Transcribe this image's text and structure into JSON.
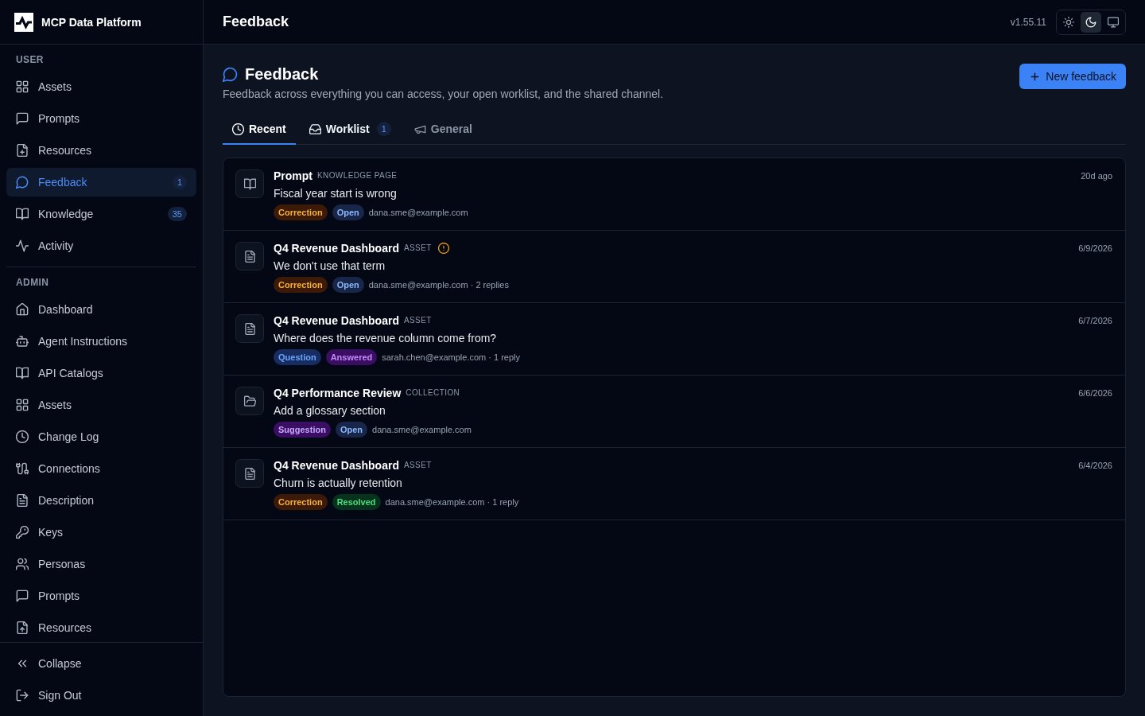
{
  "app": {
    "name": "MCP Data Platform"
  },
  "sidebar": {
    "sections": [
      {
        "heading": "USER",
        "items": [
          {
            "label": "Assets",
            "kind": "assets",
            "selected": false
          },
          {
            "label": "Prompts",
            "kind": "prompts",
            "selected": false
          },
          {
            "label": "Resources",
            "kind": "resources",
            "selected": false
          },
          {
            "label": "Feedback",
            "kind": "feedback",
            "badge": "1",
            "selected": true
          },
          {
            "label": "Knowledge",
            "kind": "knowledge",
            "badge": "35",
            "selected": false
          },
          {
            "label": "Activity",
            "kind": "activity",
            "selected": false
          }
        ]
      },
      {
        "heading": "ADMIN",
        "items": [
          {
            "label": "Dashboard",
            "kind": "dashboard",
            "selected": false
          },
          {
            "label": "Agent Instructions",
            "kind": "agent",
            "selected": false
          },
          {
            "label": "API Catalogs",
            "kind": "catalogs",
            "selected": false
          },
          {
            "label": "Assets",
            "kind": "assets",
            "selected": false
          },
          {
            "label": "Change Log",
            "kind": "changelog",
            "selected": false
          },
          {
            "label": "Connections",
            "kind": "connections",
            "selected": false
          },
          {
            "label": "Description",
            "kind": "description",
            "selected": false
          },
          {
            "label": "Keys",
            "kind": "keys",
            "selected": false
          },
          {
            "label": "Personas",
            "kind": "personas",
            "selected": false
          },
          {
            "label": "Prompts",
            "kind": "prompts",
            "selected": false
          },
          {
            "label": "Resources",
            "kind": "uploads",
            "selected": false
          }
        ]
      }
    ],
    "footer": [
      {
        "label": "Collapse",
        "kind": "collapse"
      },
      {
        "label": "Sign Out",
        "kind": "signout"
      }
    ]
  },
  "header": {
    "title": "Feedback",
    "version": "v1.55.11",
    "theme_modes": [
      {
        "kind": "light",
        "selected": false
      },
      {
        "kind": "dark",
        "selected": true
      },
      {
        "kind": "system",
        "selected": false
      }
    ]
  },
  "page": {
    "title": "Feedback",
    "subtitle": "Feedback across everything you can access, your open worklist, and the shared channel.",
    "new_button": "New feedback"
  },
  "tabs": [
    {
      "label": "Recent",
      "kind": "recent",
      "selected": true,
      "hovered": false
    },
    {
      "label": "Worklist",
      "kind": "worklist",
      "badge": "1",
      "selected": false,
      "hovered": true
    },
    {
      "label": "General",
      "kind": "general",
      "selected": false,
      "hovered": false
    }
  ],
  "feedback": [
    {
      "kind": "page",
      "target": "Prompt",
      "target_type": "KNOWLEDGE PAGE",
      "warning": false,
      "message": "Fiscal year start is wrong",
      "type": {
        "label": "Correction",
        "kind": "correction"
      },
      "status": {
        "label": "Open",
        "kind": "open"
      },
      "meta": "dana.sme@example.com",
      "time": "20d ago"
    },
    {
      "kind": "asset",
      "target": "Q4 Revenue Dashboard",
      "target_type": "ASSET",
      "warning": true,
      "message": "We don't use that term",
      "type": {
        "label": "Correction",
        "kind": "correction"
      },
      "status": {
        "label": "Open",
        "kind": "open"
      },
      "meta": "dana.sme@example.com · 2 replies",
      "time": "6/9/2026"
    },
    {
      "kind": "asset",
      "target": "Q4 Revenue Dashboard",
      "target_type": "ASSET",
      "warning": false,
      "message": "Where does the revenue column come from?",
      "type": {
        "label": "Question",
        "kind": "question"
      },
      "status": {
        "label": "Answered",
        "kind": "answered"
      },
      "meta": "sarah.chen@example.com · 1 reply",
      "time": "6/7/2026"
    },
    {
      "kind": "collection",
      "target": "Q4 Performance Review",
      "target_type": "COLLECTION",
      "warning": false,
      "message": "Add a glossary section",
      "type": {
        "label": "Suggestion",
        "kind": "suggestion"
      },
      "status": {
        "label": "Open",
        "kind": "open"
      },
      "meta": "dana.sme@example.com",
      "time": "6/6/2026"
    },
    {
      "kind": "asset",
      "target": "Q4 Revenue Dashboard",
      "target_type": "ASSET",
      "warning": false,
      "message": "Churn is actually retention",
      "type": {
        "label": "Correction",
        "kind": "correction"
      },
      "status": {
        "label": "Resolved",
        "kind": "resolved"
      },
      "meta": "dana.sme@example.com · 1 reply",
      "time": "6/4/2026"
    }
  ]
}
